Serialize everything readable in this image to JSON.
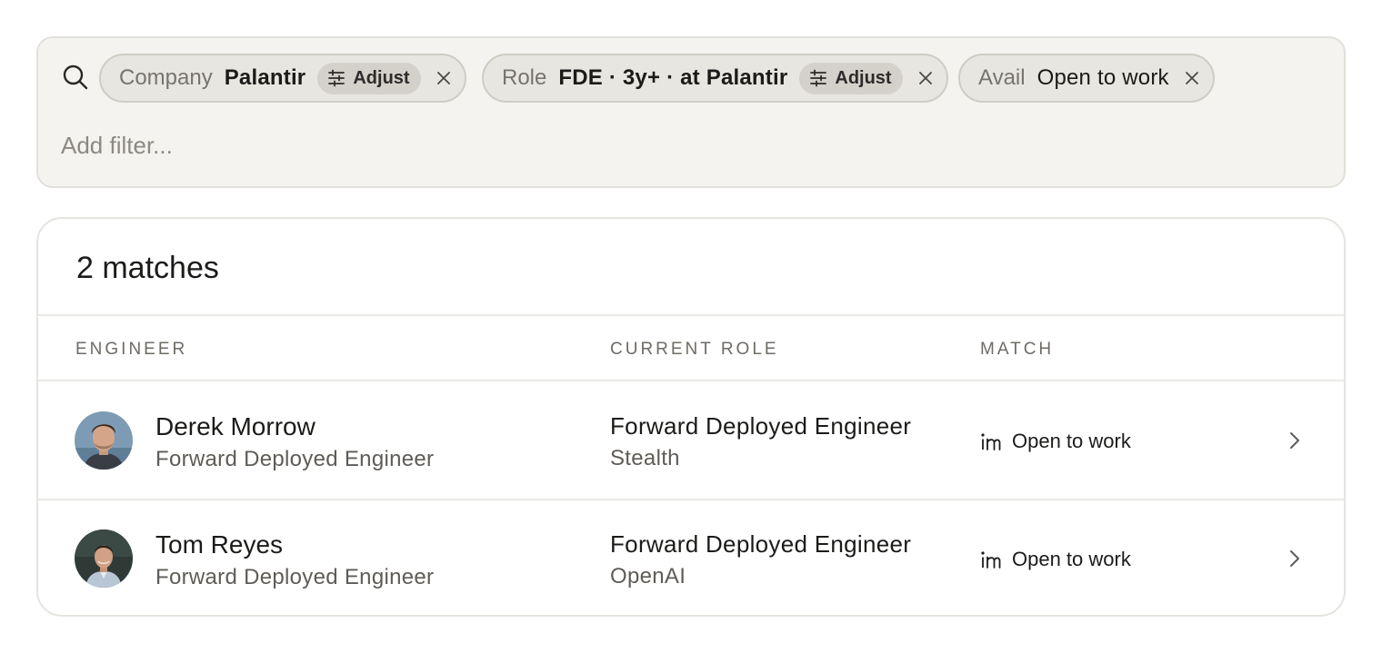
{
  "filters": {
    "search_icon": "search-icon",
    "chips": [
      {
        "key": "Company",
        "value": "Palantir",
        "adjust": "Adjust"
      },
      {
        "key": "Role",
        "value": "FDE · 3y+ · at Palantir",
        "adjust": "Adjust"
      },
      {
        "key": "Avail",
        "value": "Open to work"
      }
    ],
    "add_filter_placeholder": "Add filter..."
  },
  "results": {
    "count_label": "2 matches",
    "columns": [
      "ENGINEER",
      "CURRENT ROLE",
      "MATCH"
    ],
    "rows": [
      {
        "name": "Derek Morrow",
        "subtitle": "Forward Deployed Engineer",
        "role_title": "Forward Deployed Engineer",
        "company": "Stealth",
        "match": "Open to work",
        "match_icon": "linkedin-icon"
      },
      {
        "name": "Tom Reyes",
        "subtitle": "Forward Deployed Engineer",
        "role_title": "Forward Deployed Engineer",
        "company": "OpenAI",
        "match": "Open to work",
        "match_icon": "linkedin-icon"
      }
    ]
  },
  "colors": {
    "panel_bg": "#f4f3ef",
    "chip_bg": "#e8e6e1",
    "adjust_bg": "#d4d1cb",
    "text_primary": "#1c1b19",
    "text_secondary": "#5f5c57"
  }
}
